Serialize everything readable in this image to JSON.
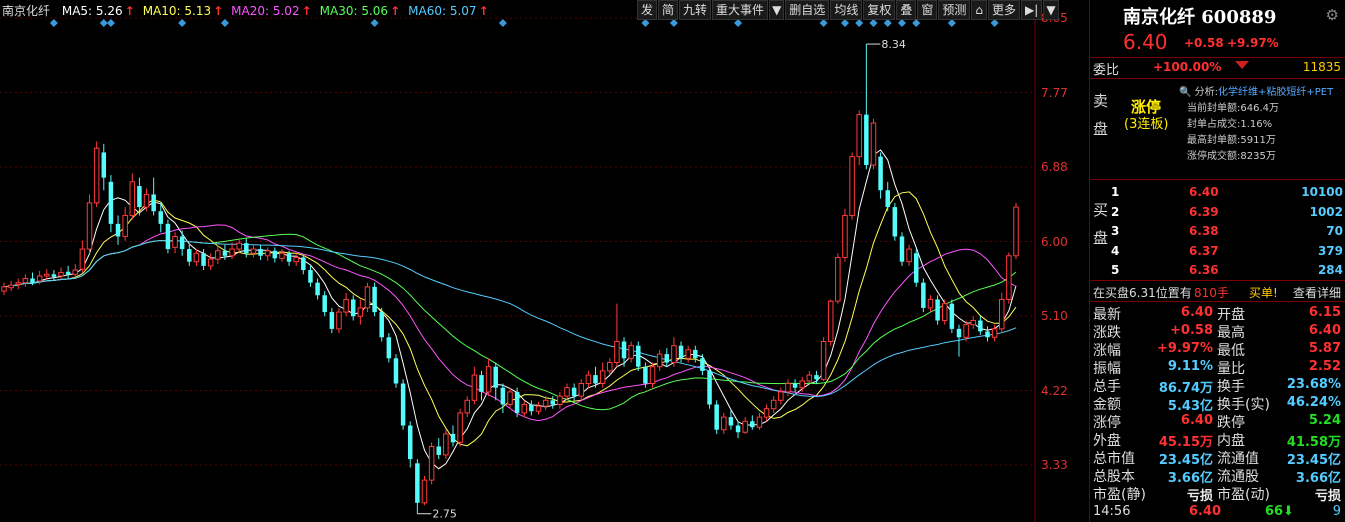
{
  "legend": {
    "title": "南京化纤",
    "ma": [
      {
        "label": "MA5: 5.26",
        "color": "#ffffff"
      },
      {
        "label": "MA10: 5.13",
        "color": "#ffff55"
      },
      {
        "label": "MA20: 5.02",
        "color": "#ff55ff"
      },
      {
        "label": "MA30: 5.06",
        "color": "#55ff55"
      },
      {
        "label": "MA60: 5.07",
        "color": "#55ccff"
      }
    ],
    "arrow": "↑"
  },
  "toolbar": [
    "发",
    "简",
    "九转",
    "重大事件",
    "▼",
    "删自选",
    "均线",
    "复权",
    "叠",
    "窗",
    "预测",
    "⌂",
    "更多",
    "▶|",
    "▼"
  ],
  "chart_data": {
    "type": "candlestick",
    "yticks": [
      "8.65",
      "7.77",
      "6.88",
      "6.00",
      "5.10",
      "4.22",
      "3.33"
    ],
    "ylim": [
      2.7,
      8.7
    ],
    "high_label": "8.34",
    "low_label": "2.75",
    "candles": [
      {
        "o": 5.4,
        "c": 5.45,
        "h": 5.5,
        "l": 5.35
      },
      {
        "o": 5.44,
        "c": 5.47,
        "h": 5.52,
        "l": 5.4
      },
      {
        "o": 5.48,
        "c": 5.5,
        "h": 5.55,
        "l": 5.42
      },
      {
        "o": 5.5,
        "c": 5.55,
        "h": 5.6,
        "l": 5.45
      },
      {
        "o": 5.55,
        "c": 5.5,
        "h": 5.62,
        "l": 5.47
      },
      {
        "o": 5.52,
        "c": 5.58,
        "h": 5.64,
        "l": 5.48
      },
      {
        "o": 5.58,
        "c": 5.6,
        "h": 5.66,
        "l": 5.53
      },
      {
        "o": 5.6,
        "c": 5.57,
        "h": 5.65,
        "l": 5.52
      },
      {
        "o": 5.58,
        "c": 5.62,
        "h": 5.68,
        "l": 5.54
      },
      {
        "o": 5.63,
        "c": 5.6,
        "h": 5.7,
        "l": 5.55
      },
      {
        "o": 5.6,
        "c": 5.65,
        "h": 5.72,
        "l": 5.56
      },
      {
        "o": 5.66,
        "c": 5.9,
        "h": 6.0,
        "l": 5.62
      },
      {
        "o": 5.9,
        "c": 6.45,
        "h": 6.55,
        "l": 5.85
      },
      {
        "o": 6.45,
        "c": 7.1,
        "h": 7.18,
        "l": 6.4
      },
      {
        "o": 7.05,
        "c": 6.75,
        "h": 7.15,
        "l": 6.6
      },
      {
        "o": 6.7,
        "c": 6.2,
        "h": 6.78,
        "l": 6.1
      },
      {
        "o": 6.2,
        "c": 6.05,
        "h": 6.3,
        "l": 5.95
      },
      {
        "o": 6.05,
        "c": 6.3,
        "h": 6.4,
        "l": 6.0
      },
      {
        "o": 6.3,
        "c": 6.7,
        "h": 6.8,
        "l": 6.25
      },
      {
        "o": 6.65,
        "c": 6.4,
        "h": 6.75,
        "l": 6.3
      },
      {
        "o": 6.4,
        "c": 6.55,
        "h": 6.62,
        "l": 6.35
      },
      {
        "o": 6.55,
        "c": 6.35,
        "h": 6.75,
        "l": 6.3
      },
      {
        "o": 6.35,
        "c": 6.2,
        "h": 6.45,
        "l": 6.1
      },
      {
        "o": 6.2,
        "c": 5.9,
        "h": 6.25,
        "l": 5.85
      },
      {
        "o": 5.92,
        "c": 6.05,
        "h": 6.1,
        "l": 5.85
      },
      {
        "o": 6.05,
        "c": 5.9,
        "h": 6.12,
        "l": 5.82
      },
      {
        "o": 5.9,
        "c": 5.75,
        "h": 5.95,
        "l": 5.7
      },
      {
        "o": 5.75,
        "c": 5.85,
        "h": 5.9,
        "l": 5.7
      },
      {
        "o": 5.85,
        "c": 5.7,
        "h": 5.9,
        "l": 5.65
      },
      {
        "o": 5.7,
        "c": 5.78,
        "h": 5.85,
        "l": 5.65
      },
      {
        "o": 5.78,
        "c": 5.88,
        "h": 5.95,
        "l": 5.72
      },
      {
        "o": 5.88,
        "c": 5.82,
        "h": 5.95,
        "l": 5.77
      },
      {
        "o": 5.82,
        "c": 5.9,
        "h": 5.98,
        "l": 5.78
      },
      {
        "o": 5.9,
        "c": 5.97,
        "h": 6.02,
        "l": 5.85
      },
      {
        "o": 5.97,
        "c": 5.85,
        "h": 6.03,
        "l": 5.8
      },
      {
        "o": 5.85,
        "c": 5.9,
        "h": 5.95,
        "l": 5.8
      },
      {
        "o": 5.9,
        "c": 5.82,
        "h": 5.95,
        "l": 5.77
      },
      {
        "o": 5.82,
        "c": 5.88,
        "h": 5.92,
        "l": 5.76
      },
      {
        "o": 5.88,
        "c": 5.79,
        "h": 5.92,
        "l": 5.74
      },
      {
        "o": 5.79,
        "c": 5.85,
        "h": 5.9,
        "l": 5.75
      },
      {
        "o": 5.85,
        "c": 5.75,
        "h": 5.88,
        "l": 5.7
      },
      {
        "o": 5.75,
        "c": 5.8,
        "h": 5.85,
        "l": 5.7
      },
      {
        "o": 5.8,
        "c": 5.65,
        "h": 5.83,
        "l": 5.6
      },
      {
        "o": 5.65,
        "c": 5.5,
        "h": 5.7,
        "l": 5.45
      },
      {
        "o": 5.5,
        "c": 5.35,
        "h": 5.55,
        "l": 5.3
      },
      {
        "o": 5.35,
        "c": 5.15,
        "h": 5.4,
        "l": 5.1
      },
      {
        "o": 5.15,
        "c": 4.95,
        "h": 5.2,
        "l": 4.9
      },
      {
        "o": 4.95,
        "c": 5.15,
        "h": 5.2,
        "l": 4.9
      },
      {
        "o": 5.15,
        "c": 5.3,
        "h": 5.38,
        "l": 5.1
      },
      {
        "o": 5.3,
        "c": 5.1,
        "h": 5.35,
        "l": 5.05
      },
      {
        "o": 5.1,
        "c": 5.2,
        "h": 5.3,
        "l": 5.0
      },
      {
        "o": 5.2,
        "c": 5.45,
        "h": 5.5,
        "l": 5.15
      },
      {
        "o": 5.45,
        "c": 5.15,
        "h": 5.5,
        "l": 5.1
      },
      {
        "o": 5.15,
        "c": 4.85,
        "h": 5.2,
        "l": 4.8
      },
      {
        "o": 4.85,
        "c": 4.6,
        "h": 4.9,
        "l": 4.55
      },
      {
        "o": 4.6,
        "c": 4.3,
        "h": 4.65,
        "l": 4.25
      },
      {
        "o": 4.3,
        "c": 3.8,
        "h": 4.35,
        "l": 3.75
      },
      {
        "o": 3.8,
        "c": 3.4,
        "h": 3.85,
        "l": 3.3
      },
      {
        "o": 3.35,
        "c": 2.88,
        "h": 3.4,
        "l": 2.75
      },
      {
        "o": 2.88,
        "c": 3.15,
        "h": 3.2,
        "l": 2.85
      },
      {
        "o": 3.15,
        "c": 3.55,
        "h": 3.6,
        "l": 3.1
      },
      {
        "o": 3.55,
        "c": 3.45,
        "h": 3.65,
        "l": 3.4
      },
      {
        "o": 3.45,
        "c": 3.7,
        "h": 3.75,
        "l": 3.4
      },
      {
        "o": 3.7,
        "c": 3.6,
        "h": 3.8,
        "l": 3.55
      },
      {
        "o": 3.6,
        "c": 3.95,
        "h": 4.0,
        "l": 3.55
      },
      {
        "o": 3.95,
        "c": 4.1,
        "h": 4.15,
        "l": 3.9
      },
      {
        "o": 4.1,
        "c": 4.4,
        "h": 4.5,
        "l": 4.05
      },
      {
        "o": 4.4,
        "c": 4.2,
        "h": 4.45,
        "l": 4.1
      },
      {
        "o": 4.2,
        "c": 4.5,
        "h": 4.6,
        "l": 4.15
      },
      {
        "o": 4.5,
        "c": 4.25,
        "h": 4.55,
        "l": 4.1
      },
      {
        "o": 4.25,
        "c": 4.05,
        "h": 4.3,
        "l": 3.95
      },
      {
        "o": 4.05,
        "c": 4.2,
        "h": 4.25,
        "l": 4.0
      },
      {
        "o": 4.2,
        "c": 3.95,
        "h": 4.25,
        "l": 3.9
      },
      {
        "o": 3.95,
        "c": 4.05,
        "h": 4.1,
        "l": 3.9
      },
      {
        "o": 4.05,
        "c": 3.97,
        "h": 4.1,
        "l": 3.92
      },
      {
        "o": 3.97,
        "c": 4.03,
        "h": 4.08,
        "l": 3.93
      },
      {
        "o": 4.03,
        "c": 4.1,
        "h": 4.15,
        "l": 3.98
      },
      {
        "o": 4.1,
        "c": 4.05,
        "h": 4.15,
        "l": 4.0
      },
      {
        "o": 4.05,
        "c": 4.15,
        "h": 4.2,
        "l": 4.0
      },
      {
        "o": 4.15,
        "c": 4.25,
        "h": 4.3,
        "l": 4.1
      },
      {
        "o": 4.25,
        "c": 4.15,
        "h": 4.3,
        "l": 4.1
      },
      {
        "o": 4.15,
        "c": 4.3,
        "h": 4.35,
        "l": 4.1
      },
      {
        "o": 4.3,
        "c": 4.4,
        "h": 4.45,
        "l": 4.25
      },
      {
        "o": 4.4,
        "c": 4.3,
        "h": 4.5,
        "l": 4.25
      },
      {
        "o": 4.3,
        "c": 4.45,
        "h": 4.55,
        "l": 4.25
      },
      {
        "o": 4.45,
        "c": 4.55,
        "h": 4.6,
        "l": 4.4
      },
      {
        "o": 4.55,
        "c": 4.8,
        "h": 5.25,
        "l": 4.5
      },
      {
        "o": 4.8,
        "c": 4.6,
        "h": 4.85,
        "l": 4.5
      },
      {
        "o": 4.6,
        "c": 4.75,
        "h": 4.8,
        "l": 4.55
      },
      {
        "o": 4.75,
        "c": 4.5,
        "h": 4.8,
        "l": 4.45
      },
      {
        "o": 4.5,
        "c": 4.3,
        "h": 4.55,
        "l": 4.25
      },
      {
        "o": 4.3,
        "c": 4.5,
        "h": 4.55,
        "l": 4.25
      },
      {
        "o": 4.5,
        "c": 4.65,
        "h": 4.7,
        "l": 4.45
      },
      {
        "o": 4.65,
        "c": 4.55,
        "h": 4.72,
        "l": 4.5
      },
      {
        "o": 4.55,
        "c": 4.75,
        "h": 4.85,
        "l": 4.5
      },
      {
        "o": 4.75,
        "c": 4.6,
        "h": 4.8,
        "l": 4.55
      },
      {
        "o": 4.6,
        "c": 4.7,
        "h": 4.75,
        "l": 4.55
      },
      {
        "o": 4.7,
        "c": 4.6,
        "h": 4.75,
        "l": 4.55
      },
      {
        "o": 4.6,
        "c": 4.45,
        "h": 4.65,
        "l": 4.4
      },
      {
        "o": 4.45,
        "c": 4.05,
        "h": 4.5,
        "l": 4.0
      },
      {
        "o": 4.05,
        "c": 3.75,
        "h": 4.1,
        "l": 3.7
      },
      {
        "o": 3.75,
        "c": 3.9,
        "h": 3.95,
        "l": 3.7
      },
      {
        "o": 3.9,
        "c": 3.8,
        "h": 3.98,
        "l": 3.75
      },
      {
        "o": 3.8,
        "c": 3.72,
        "h": 3.85,
        "l": 3.65
      },
      {
        "o": 3.72,
        "c": 3.85,
        "h": 3.9,
        "l": 3.7
      },
      {
        "o": 3.85,
        "c": 3.78,
        "h": 3.92,
        "l": 3.75
      },
      {
        "o": 3.78,
        "c": 3.9,
        "h": 3.95,
        "l": 3.75
      },
      {
        "o": 3.9,
        "c": 4.0,
        "h": 4.05,
        "l": 3.85
      },
      {
        "o": 4.0,
        "c": 4.1,
        "h": 4.15,
        "l": 3.95
      },
      {
        "o": 4.1,
        "c": 4.2,
        "h": 4.25,
        "l": 4.05
      },
      {
        "o": 4.2,
        "c": 4.3,
        "h": 4.35,
        "l": 4.15
      },
      {
        "o": 4.3,
        "c": 4.25,
        "h": 4.35,
        "l": 4.2
      },
      {
        "o": 4.25,
        "c": 4.33,
        "h": 4.38,
        "l": 4.2
      },
      {
        "o": 4.33,
        "c": 4.4,
        "h": 4.45,
        "l": 4.3
      },
      {
        "o": 4.4,
        "c": 4.35,
        "h": 4.45,
        "l": 4.3
      },
      {
        "o": 4.35,
        "c": 4.8,
        "h": 4.85,
        "l": 4.33
      },
      {
        "o": 4.8,
        "c": 5.28,
        "h": 5.3,
        "l": 4.75
      },
      {
        "o": 5.28,
        "c": 5.8,
        "h": 5.85,
        "l": 5.25
      },
      {
        "o": 5.8,
        "c": 6.3,
        "h": 6.38,
        "l": 5.75
      },
      {
        "o": 6.3,
        "c": 7.0,
        "h": 7.05,
        "l": 6.25
      },
      {
        "o": 7.0,
        "c": 7.5,
        "h": 7.55,
        "l": 6.9
      },
      {
        "o": 7.5,
        "c": 6.9,
        "h": 8.34,
        "l": 6.85
      },
      {
        "o": 6.9,
        "c": 7.4,
        "h": 7.45,
        "l": 6.85
      },
      {
        "o": 7.0,
        "c": 6.6,
        "h": 7.05,
        "l": 6.5
      },
      {
        "o": 6.6,
        "c": 6.4,
        "h": 6.7,
        "l": 6.35
      },
      {
        "o": 6.4,
        "c": 6.05,
        "h": 6.45,
        "l": 6.0
      },
      {
        "o": 6.05,
        "c": 5.75,
        "h": 6.1,
        "l": 5.7
      },
      {
        "o": 5.75,
        "c": 5.9,
        "h": 5.95,
        "l": 5.7
      },
      {
        "o": 5.85,
        "c": 5.5,
        "h": 5.9,
        "l": 5.45
      },
      {
        "o": 5.5,
        "c": 5.2,
        "h": 5.55,
        "l": 5.15
      },
      {
        "o": 5.2,
        "c": 5.3,
        "h": 5.35,
        "l": 5.15
      },
      {
        "o": 5.3,
        "c": 5.05,
        "h": 5.35,
        "l": 5.0
      },
      {
        "o": 5.05,
        "c": 5.25,
        "h": 5.3,
        "l": 5.0
      },
      {
        "o": 5.25,
        "c": 4.95,
        "h": 5.3,
        "l": 4.9
      },
      {
        "o": 4.95,
        "c": 4.85,
        "h": 5.0,
        "l": 4.62
      },
      {
        "o": 4.85,
        "c": 5.0,
        "h": 5.05,
        "l": 4.8
      },
      {
        "o": 5.0,
        "c": 5.05,
        "h": 5.1,
        "l": 4.95
      },
      {
        "o": 5.05,
        "c": 4.92,
        "h": 5.1,
        "l": 4.88
      },
      {
        "o": 4.92,
        "c": 4.85,
        "h": 4.98,
        "l": 4.8
      },
      {
        "o": 4.85,
        "c": 4.95,
        "h": 5.0,
        "l": 4.8
      },
      {
        "o": 4.95,
        "c": 5.3,
        "h": 5.38,
        "l": 4.9
      },
      {
        "o": 5.3,
        "c": 5.82,
        "h": 5.86,
        "l": 5.25
      },
      {
        "o": 5.82,
        "c": 6.4,
        "h": 6.45,
        "l": 5.78
      }
    ]
  },
  "side": {
    "name": "南京化纤",
    "code": "600889",
    "price": "6.40",
    "change": "+0.58",
    "change_pct": "+9.97%",
    "weibi_label": "委比",
    "weibi_pct": "+100.00%",
    "weibi_vol": "11835",
    "sell_label_1": "卖",
    "sell_label_2": "盘",
    "zhangting": "涨停",
    "lianban": "(3连板)",
    "analysis_prefix": "分析:",
    "analysis": "化学纤维+粘胶短纤+PET",
    "info": [
      "当前封单额:646.4万",
      "封单占成交:1.16%",
      "最高封单额:5911万",
      "涨停成交额:8235万"
    ],
    "buy_label_1": "买",
    "buy_label_2": "盘",
    "buy": [
      {
        "n": "1",
        "p": "6.40",
        "v": "10100"
      },
      {
        "n": "2",
        "p": "6.39",
        "v": "1002"
      },
      {
        "n": "3",
        "p": "6.38",
        "v": "70"
      },
      {
        "n": "4",
        "p": "6.37",
        "v": "379"
      },
      {
        "n": "5",
        "p": "6.36",
        "v": "284"
      }
    ],
    "tip": {
      "t1": "在买盘6.31位置有",
      "t2": "810手",
      "t3": "买单!",
      "t4": "查看详细"
    },
    "quotes": [
      {
        "l1": "最新",
        "v1": "6.40",
        "c1": "red",
        "l2": "开盘",
        "v2": "6.15",
        "c2": "red"
      },
      {
        "l1": "涨跌",
        "v1": "+0.58",
        "c1": "red",
        "l2": "最高",
        "v2": "6.40",
        "c2": "red"
      },
      {
        "l1": "涨幅",
        "v1": "+9.97%",
        "c1": "red",
        "l2": "最低",
        "v2": "5.87",
        "c2": "red"
      },
      {
        "l1": "振幅",
        "v1": "9.11%",
        "c1": "cyan",
        "l2": "量比",
        "v2": "2.52",
        "c2": "red"
      },
      {
        "l1": "总手",
        "v1": "86.74万",
        "c1": "cyan",
        "l2": "换手",
        "v2": "23.68%",
        "c2": "cyan"
      },
      {
        "l1": "金额",
        "v1": "5.43亿",
        "c1": "cyan",
        "l2": "换手(实)",
        "v2": "46.24%",
        "c2": "cyan"
      },
      {
        "l1": "涨停",
        "v1": "6.40",
        "c1": "red",
        "l2": "跌停",
        "v2": "5.24",
        "c2": "green"
      },
      {
        "l1": "外盘",
        "v1": "45.15万",
        "c1": "red",
        "l2": "内盘",
        "v2": "41.58万",
        "c2": "green"
      },
      {
        "l1": "总市值",
        "v1": "23.45亿",
        "c1": "cyan",
        "l2": "流通值",
        "v2": "23.45亿",
        "c2": "cyan"
      },
      {
        "l1": "总股本",
        "v1": "3.66亿",
        "c1": "cyan",
        "l2": "流通股",
        "v2": "3.66亿",
        "c2": "cyan"
      },
      {
        "l1": "市盈(静)",
        "v1": "亏损",
        "c1": "white",
        "l2": "市盈(动)",
        "v2": "亏损",
        "c2": "white"
      }
    ],
    "status": {
      "time": "14:56",
      "price": "6.40",
      "vol": "66",
      "arrow": "⬇",
      "count": "9"
    }
  }
}
